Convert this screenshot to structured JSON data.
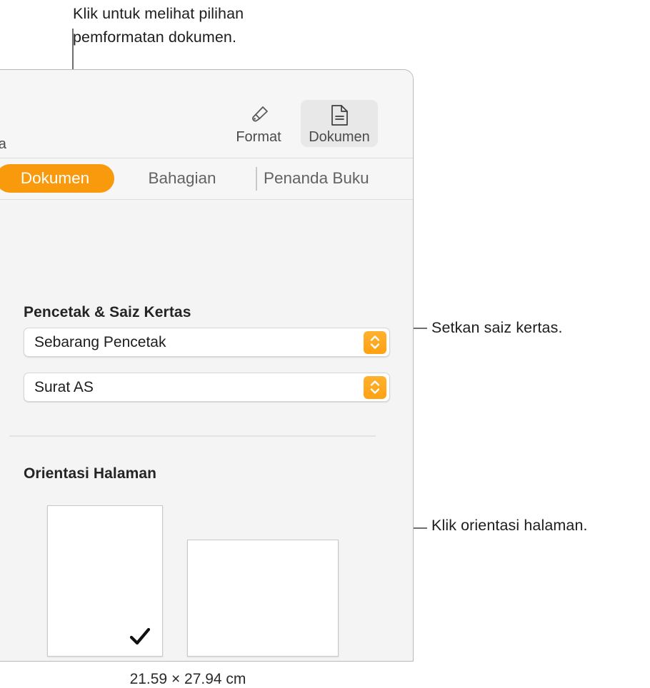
{
  "callouts": {
    "top": "Klik untuk melihat pilihan\npemformatan dokumen.",
    "paper_size": "Setkan saiz kertas.",
    "orientation": "Klik orientasi halaman."
  },
  "toolbar": {
    "collaborate_label": "sama",
    "items": [
      {
        "label": "Format",
        "icon": "paintbrush-icon",
        "selected": false
      },
      {
        "label": "Dokumen",
        "icon": "document-page-icon",
        "selected": true
      }
    ]
  },
  "tabs": [
    {
      "label": "Dokumen",
      "selected": true
    },
    {
      "label": "Bahagian",
      "selected": false
    },
    {
      "label": "Penanda Buku",
      "selected": false
    }
  ],
  "sections": {
    "printer_paper": {
      "title": "Pencetak & Saiz Kertas",
      "printer": {
        "value": "Sebarang Pencetak",
        "stepper_icon": "chevron-up-down-icon"
      },
      "paper_size": {
        "value": "Surat AS",
        "stepper_icon": "chevron-up-down-icon"
      }
    },
    "orientation": {
      "title": "Orientasi Halaman",
      "options": [
        {
          "name": "portrait",
          "selected": true,
          "check_icon": "checkmark-icon"
        },
        {
          "name": "landscape",
          "selected": false
        }
      ],
      "dimensions": "21.59 × 27.94 cm"
    }
  },
  "colors": {
    "accent_tab": "#F89A0C",
    "accent_stepper": "#FFA913",
    "panel_bg": "#F4F4F4",
    "text": "#1D1D1F",
    "leader_line": "#6E6E73"
  }
}
